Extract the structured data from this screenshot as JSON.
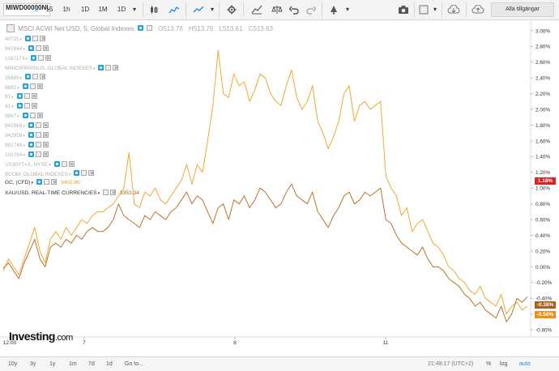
{
  "toolbar": {
    "symbol": "MIWD00000NUS",
    "intervals": [
      "5",
      "15",
      "1h",
      "1D",
      "1M",
      "1D"
    ],
    "selected_interval": "5",
    "account_label": "Alla tillgängar"
  },
  "legend": {
    "main_title": "MSCI ACWI Net USD, 5, Global Indexes",
    "ohlc": {
      "o": "O513.76",
      "h": "H513.76",
      "l": "L513.61",
      "c": "C513.63"
    },
    "hidden_rows": [
      "40725",
      "942944",
      "1187173",
      "MIWD00000NUS, GLOBAL INDEXES",
      "25685",
      "8892",
      "61",
      "41",
      "8867",
      "942968",
      "942959",
      "992749",
      "101764",
      "US30YT=X, NYSE",
      "BCOM, GLOBAL INDEXES"
    ],
    "gc_label": "GC, (CFD)",
    "gc_value": "3402.90",
    "xau_label": "XAU/USD, REAL-TIME CURRENCIES",
    "xau_value": "3353.34"
  },
  "axis": {
    "y_ticks": [
      "3.00%",
      "2.80%",
      "2.60%",
      "2.40%",
      "2.20%",
      "2.00%",
      "1.80%",
      "1.60%",
      "1.40%",
      "1.20%",
      "1.00%",
      "0.80%",
      "0.60%",
      "0.40%",
      "0.20%",
      "0.00%",
      "-0.20%",
      "-0.40%",
      "-0.60%",
      "-0.80%"
    ],
    "x_ticks": [
      "12:00",
      "7",
      "8",
      "11"
    ],
    "price_tags": {
      "red": "1.18%",
      "brown": "-0.38%",
      "gold": "-0.50%"
    }
  },
  "colors": {
    "gold": "#f0a830",
    "brown": "#b8732a",
    "red": "#e02020",
    "tag_brown": "#a8621e",
    "tag_gold": "#e8901a"
  },
  "chart_data": {
    "type": "line",
    "y_unit": "%",
    "ylim": [
      -0.85,
      3.05
    ],
    "x_ticks": [
      "12:00",
      "7",
      "8",
      "11"
    ],
    "series": [
      {
        "name": "GC, (CFD)",
        "values": [
          -0.05,
          0.1,
          0.0,
          -0.1,
          0.1,
          0.3,
          0.5,
          0.2,
          0.05,
          0.35,
          0.45,
          0.35,
          0.5,
          0.4,
          0.5,
          0.6,
          0.55,
          0.65,
          0.7,
          0.7,
          0.75,
          0.8,
          0.9,
          1.0,
          1.45,
          0.8,
          0.75,
          0.95,
          0.9,
          1.0,
          0.85,
          0.8,
          0.9,
          1.0,
          1.1,
          1.3,
          1.05,
          1.3,
          1.2,
          1.6,
          2.05,
          2.75,
          2.2,
          2.15,
          2.45,
          2.3,
          2.35,
          2.1,
          2.25,
          2.45,
          2.4,
          2.2,
          2.1,
          2.05,
          2.3,
          2.5,
          2.15,
          2.0,
          2.1,
          2.3,
          1.85,
          1.7,
          1.5,
          1.65,
          1.85,
          2.2,
          2.3,
          1.85,
          2.05,
          2.1,
          2.0,
          2.05,
          2.1,
          1.15,
          1.0,
          0.9,
          0.65,
          0.75,
          0.45,
          0.55,
          0.6,
          0.45,
          0.3,
          0.25,
          0.15,
          0.0,
          -0.05,
          -0.15,
          -0.2,
          -0.3,
          -0.35,
          -0.25,
          -0.4,
          -0.45,
          -0.5,
          -0.35,
          -0.6,
          -0.5,
          -0.45,
          -0.55,
          -0.5
        ]
      },
      {
        "name": "XAU/USD, REAL-TIME CURRENCIES",
        "values": [
          -0.02,
          0.05,
          -0.05,
          -0.15,
          0.05,
          0.2,
          0.35,
          0.1,
          0.0,
          0.25,
          0.3,
          0.25,
          0.35,
          0.3,
          0.4,
          0.35,
          0.45,
          0.5,
          0.45,
          0.45,
          0.5,
          0.6,
          0.8,
          0.65,
          0.6,
          0.55,
          0.5,
          0.65,
          0.6,
          0.7,
          0.65,
          0.6,
          0.7,
          0.75,
          0.85,
          0.95,
          0.8,
          0.9,
          0.85,
          0.7,
          0.55,
          0.75,
          0.8,
          0.6,
          0.85,
          0.8,
          0.9,
          0.75,
          0.85,
          1.0,
          0.95,
          0.85,
          0.75,
          0.8,
          0.95,
          1.05,
          0.9,
          0.85,
          0.8,
          0.95,
          0.7,
          0.6,
          0.5,
          0.65,
          0.75,
          0.9,
          0.95,
          0.8,
          0.85,
          0.95,
          0.9,
          0.95,
          1.0,
          0.6,
          0.55,
          0.4,
          0.3,
          0.25,
          0.2,
          0.15,
          0.25,
          0.1,
          0.0,
          0.0,
          -0.05,
          -0.15,
          -0.2,
          -0.25,
          -0.35,
          -0.4,
          -0.5,
          -0.45,
          -0.55,
          -0.6,
          -0.65,
          -0.5,
          -0.7,
          -0.6,
          -0.4,
          -0.45,
          -0.38
        ]
      }
    ]
  },
  "bottom": {
    "ranges": [
      "10y",
      "3y",
      "1y",
      "1m",
      "7d",
      "1d"
    ],
    "goto": "Go to...",
    "time": "21:48:17 (UTC+2)",
    "pct": "%",
    "log": "log",
    "auto": "auto"
  },
  "branding": {
    "logo_main": "Investing",
    "logo_suffix": ".com"
  }
}
